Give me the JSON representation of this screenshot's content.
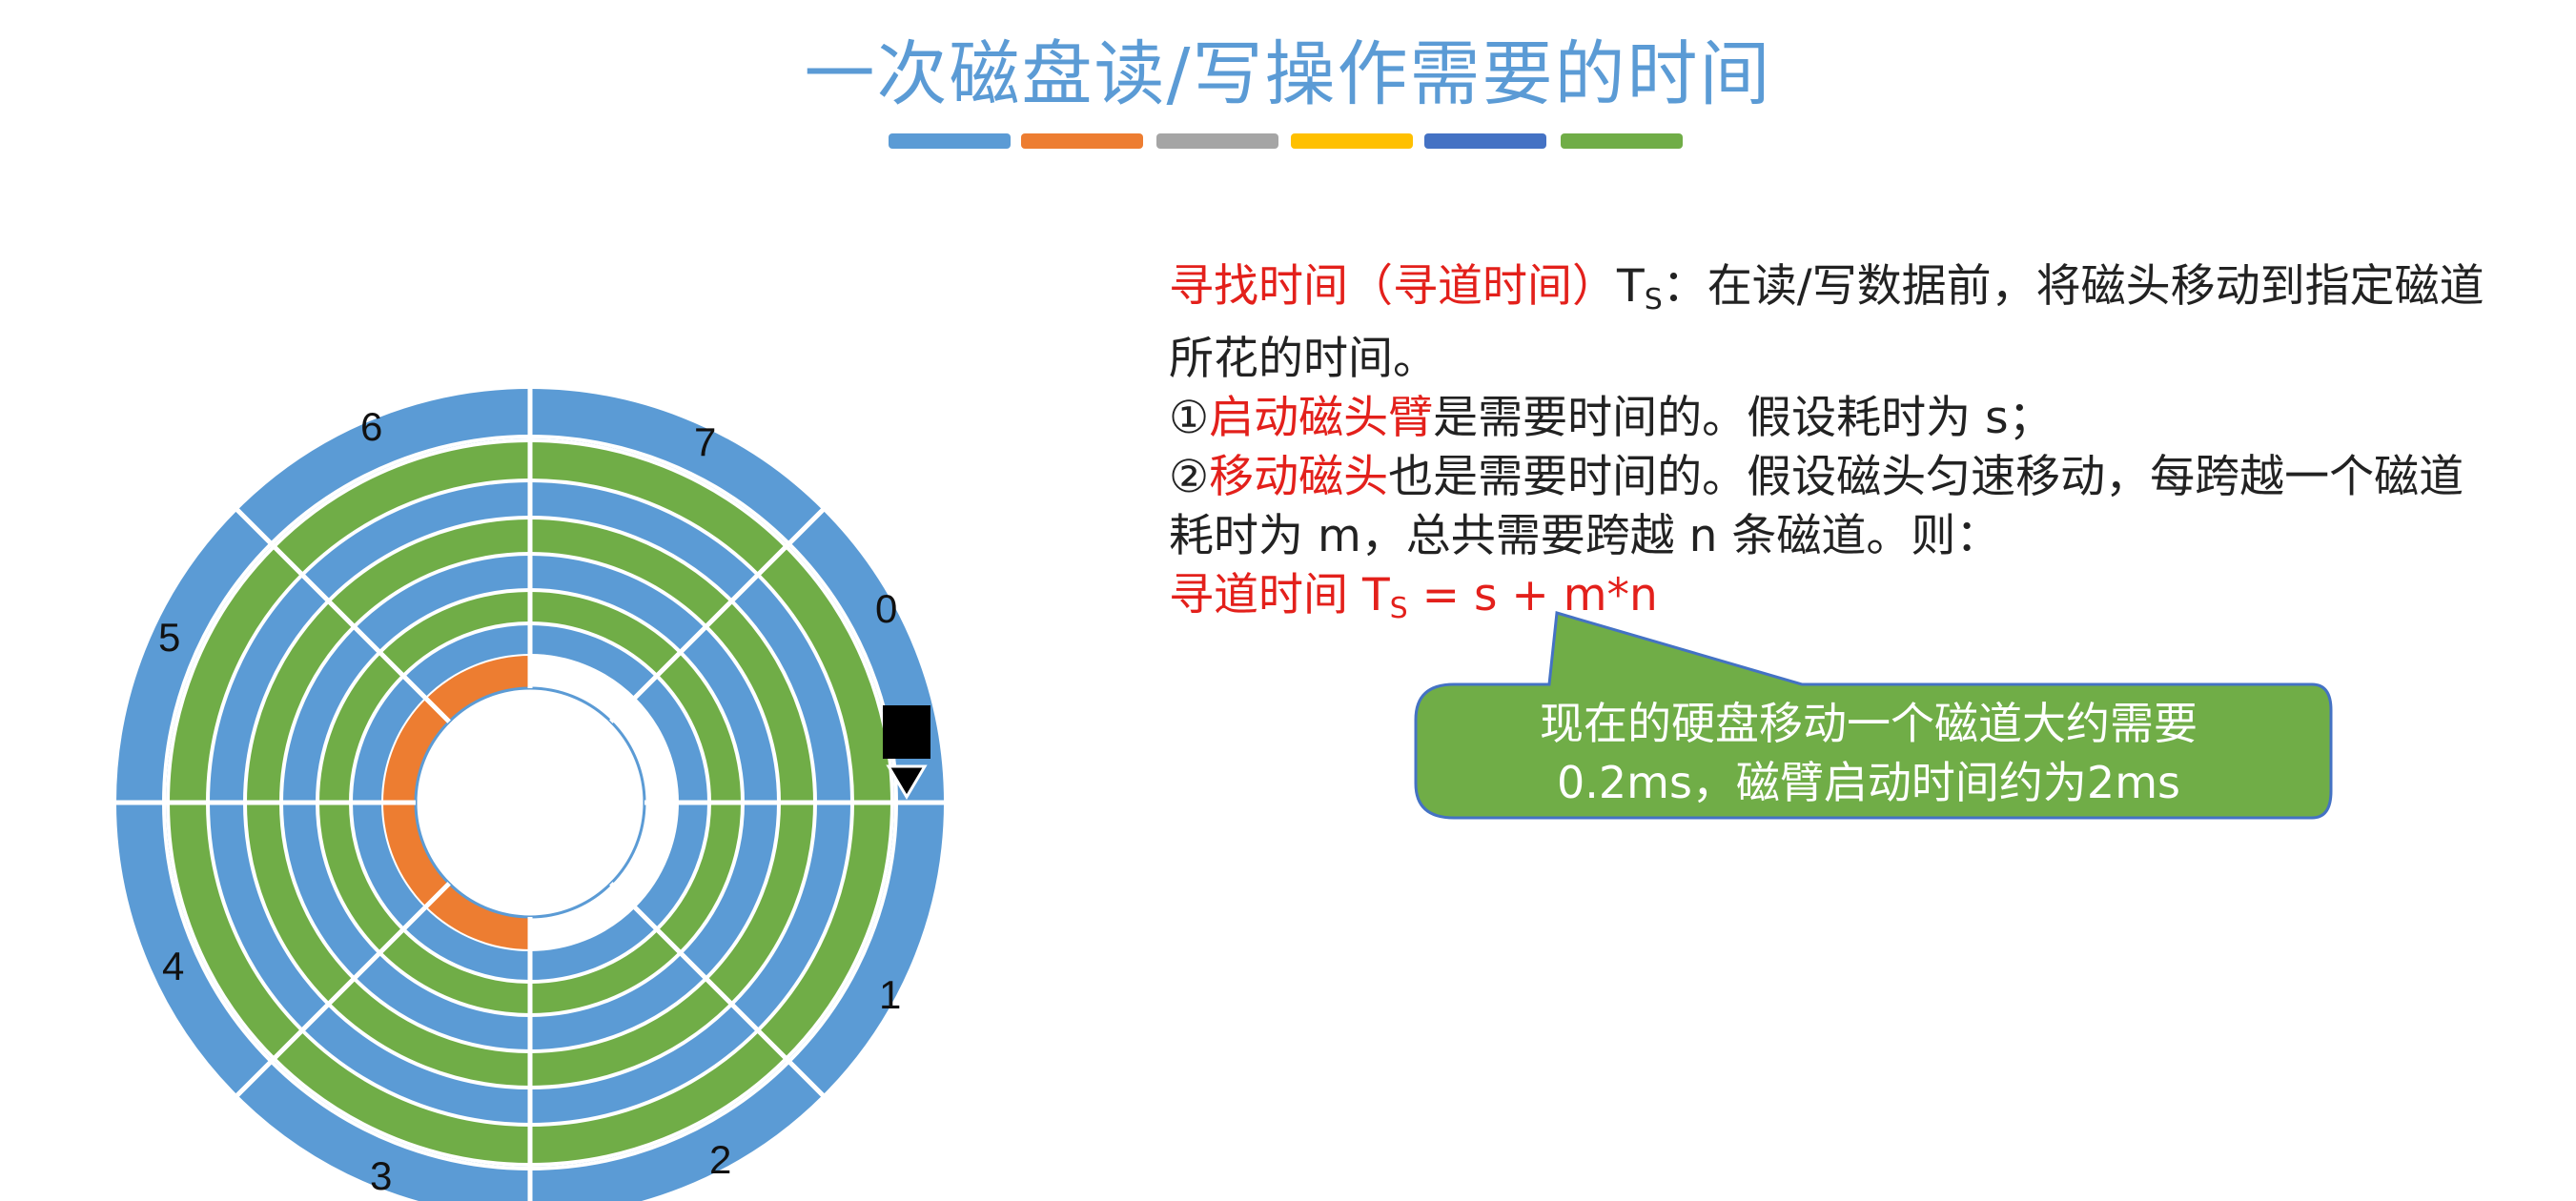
{
  "title": "一次磁盘读/写操作需要的时间",
  "title_bar_colors": [
    "#5b9bd5",
    "#ed7d31",
    "#a5a5a5",
    "#ffc000",
    "#4472c4",
    "#70ad47"
  ],
  "disk": {
    "sector_labels": [
      "0",
      "1",
      "2",
      "3",
      "4",
      "5",
      "6",
      "7"
    ],
    "colors": {
      "outer_track": "#5b9bd5",
      "track_a": "#70ad47",
      "track_b": "#5b9bd5",
      "highlight": "#ed7d31",
      "divider": "#ffffff"
    }
  },
  "text": {
    "line1": {
      "red_part": "寻找时间（寻道时间）",
      "symbol": "T",
      "symbol_sub": "S",
      "black_part": "：在读/写数据前，将磁头移动到指定磁道所花的时间。"
    },
    "item1": {
      "prefix": "①",
      "red_part": "启动磁头臂",
      "black_part": "是需要时间的。假设耗时为 s；"
    },
    "item2": {
      "prefix": "②",
      "red_part": "移动磁头",
      "black_part": "也是需要时间的。假设磁头匀速移动，每跨越一个磁道耗时为 m，总共需要跨越 n 条磁道。则："
    },
    "formula": {
      "label": "寻道时间 ",
      "symbol": "T",
      "symbol_sub": "S",
      "expression": " = s + m*n"
    }
  },
  "callout": {
    "line1": "现在的硬盘移动一个磁道大约需要",
    "line2": "0.2ms，磁臂启动时间约为2ms",
    "fill": "#70ad47",
    "stroke": "#4472c4"
  }
}
